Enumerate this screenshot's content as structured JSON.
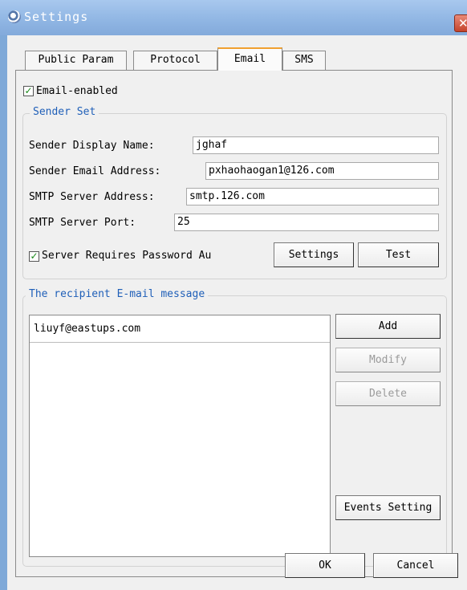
{
  "window": {
    "title": "Settings"
  },
  "tabs": [
    {
      "label": "Public Param"
    },
    {
      "label": "Protocol"
    },
    {
      "label": "Email"
    },
    {
      "label": "SMS"
    }
  ],
  "email_enabled": {
    "label": "Email-enabled",
    "checked": true
  },
  "sender": {
    "legend": "Sender Set",
    "display_name_label": "Sender Display Name:",
    "display_name_value": "jghaf",
    "email_label": "Sender Email Address:",
    "email_value": "pxhaohaogan1@126.com",
    "smtp_address_label": "SMTP Server Address:",
    "smtp_address_value": "smtp.126.com",
    "smtp_port_label": "SMTP Server Port:",
    "smtp_port_value": "25",
    "password_auth_label": "Server Requires Password Au",
    "password_auth_checked": true,
    "settings_label": "Settings",
    "test_label": "Test"
  },
  "recipients": {
    "legend": "The recipient E-mail message",
    "items": [
      "liuyf@eastups.com"
    ],
    "add_label": "Add",
    "modify_label": "Modify",
    "delete_label": "Delete",
    "events_label": "Events Setting"
  },
  "footer": {
    "ok_label": "OK",
    "cancel_label": "Cancel"
  },
  "colors": {
    "accent_legend": "#1f5fb8",
    "active_tab_top": "#f0a030",
    "titlebar": "#8fb5e3"
  }
}
